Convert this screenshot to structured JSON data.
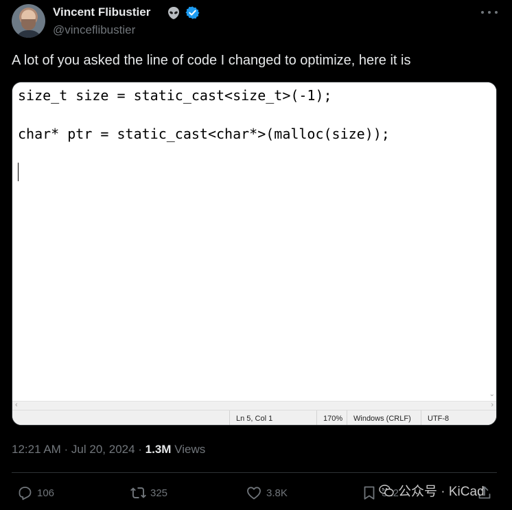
{
  "author": {
    "display_name": "Vincent Flibustier",
    "handle": "@vinceflibustier",
    "name_emoji": "alien-icon",
    "verified": "verified-badge-icon"
  },
  "tweet_text": "A lot of you asked the line of code I changed to optimize, here it is",
  "media": {
    "code_lines": [
      "size_t size = static_cast<size_t>(-1);",
      "char* ptr = static_cast<char*>(malloc(size));"
    ],
    "status": {
      "position": "Ln 5, Col 1",
      "zoom": "170%",
      "line_endings": "Windows (CRLF)",
      "encoding": "UTF-8"
    }
  },
  "meta": {
    "time": "12:21 AM · Jul 20, 2024 · ",
    "views_count": "1.3M",
    "views_label": " Views"
  },
  "actions": {
    "replies": "106",
    "reposts": "325",
    "likes": "3.8K",
    "bookmarks": "312"
  },
  "watermark": "公众号 · KiCad",
  "colors": {
    "background": "#000000",
    "text": "#e7e9ea",
    "muted": "#71767b",
    "verified": "#1d9bf0"
  }
}
